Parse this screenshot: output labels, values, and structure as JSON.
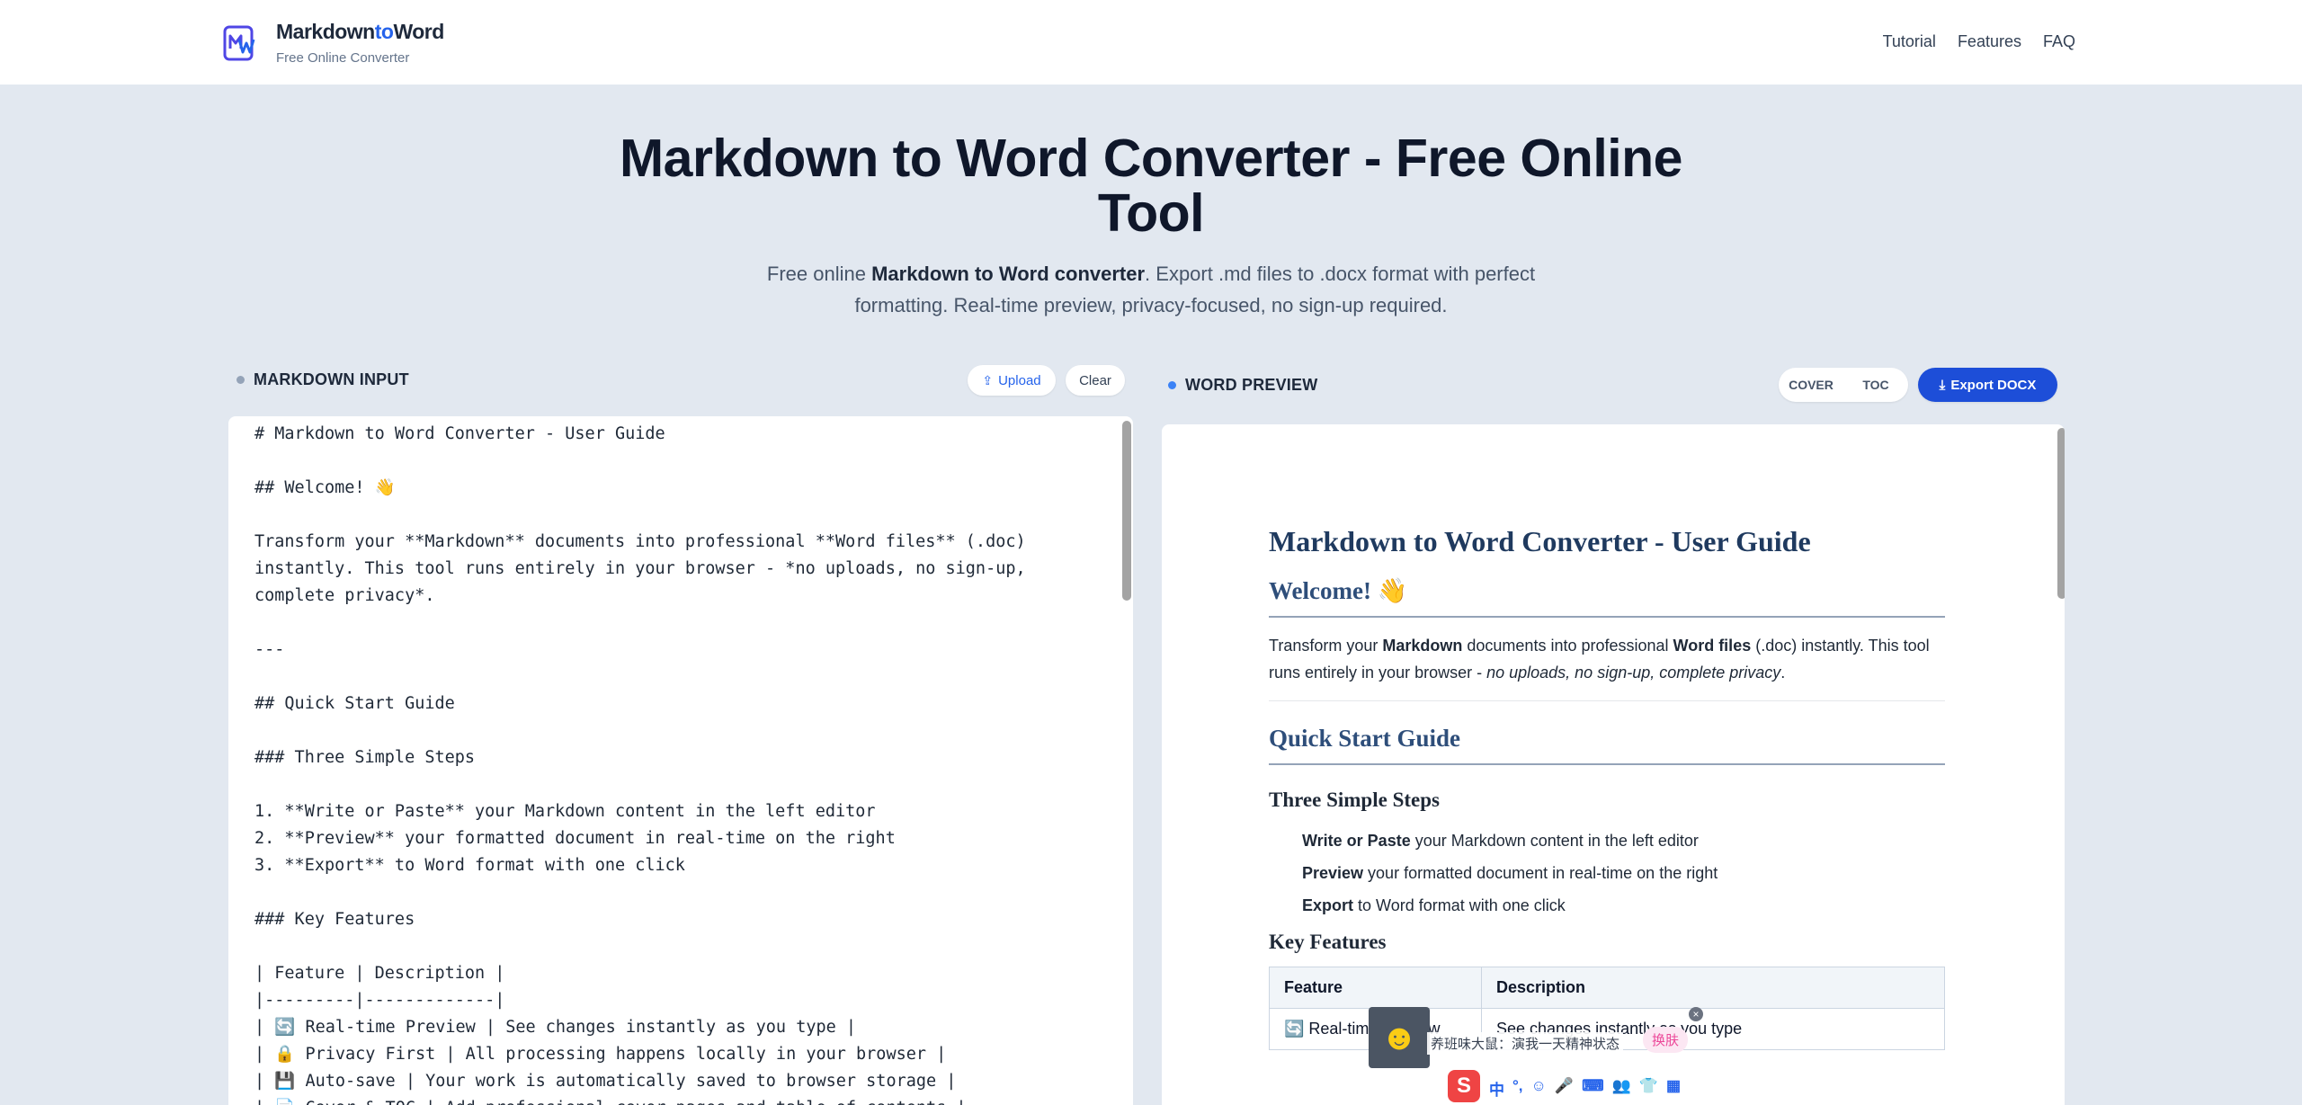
{
  "header": {
    "brand_part1": "Markdown",
    "brand_part2": "to",
    "brand_part3": "Word",
    "subtitle": "Free Online Converter",
    "nav": [
      "Tutorial",
      "Features",
      "FAQ"
    ]
  },
  "hero": {
    "title": "Markdown to Word Converter - Free Online Tool",
    "sub_1": "Free online ",
    "sub_bold": "Markdown to Word converter",
    "sub_2": ". Export .md files to .docx format with perfect formatting. Real-time preview, privacy-focused, no sign-up required."
  },
  "input_panel": {
    "label": "MARKDOWN INPUT",
    "upload_label": "Upload",
    "clear_label": "Clear",
    "lines": [
      "# Markdown to Word Converter - User Guide",
      "",
      "## Welcome! 👋",
      "",
      "Transform your **Markdown** documents into professional **Word files** (.doc)",
      "instantly. This tool runs entirely in your browser - *no uploads, no sign-up,",
      "complete privacy*.",
      "",
      "---",
      "",
      "## Quick Start Guide",
      "",
      "### Three Simple Steps",
      "",
      "1. **Write or Paste** your Markdown content in the left editor",
      "2. **Preview** your formatted document in real-time on the right",
      "3. **Export** to Word format with one click",
      "",
      "### Key Features",
      "",
      "| Feature | Description |",
      "|---------|-------------|",
      "| 🔄 Real-time Preview | See changes instantly as you type |",
      "| 🔒 Privacy First | All processing happens locally in your browser |",
      "| 💾 Auto-save | Your work is automatically saved to browser storage |",
      "| 📄 Cover & TOC | Add professional cover pages and table of contents |"
    ]
  },
  "preview_panel": {
    "label": "WORD PREVIEW",
    "cover_label": "COVER",
    "toc_label": "TOC",
    "export_label": "Export DOCX",
    "doc": {
      "h1": "Markdown to Word Converter - User Guide",
      "welcome": "Welcome! 👋",
      "p_1": "Transform your ",
      "p_b1": "Markdown",
      "p_2": " documents into professional ",
      "p_b2": "Word files",
      "p_3": " (.doc) instantly. This tool runs entirely in your browser - ",
      "p_i": "no uploads, no sign-up, complete privacy",
      "p_4": ".",
      "quick_start": "Quick Start Guide",
      "three_steps": "Three Simple Steps",
      "steps": [
        {
          "bold": "Write or Paste",
          "rest": " your Markdown content in the left editor"
        },
        {
          "bold": "Preview",
          "rest": " your formatted document in real-time on the right"
        },
        {
          "bold": "Export",
          "rest": " to Word format with one click"
        }
      ],
      "key_features": "Key Features",
      "table_header": [
        "Feature",
        "Description"
      ],
      "table_row_1": [
        "🔄 Real-time Preview",
        "See changes instantly as you type"
      ]
    }
  },
  "ime": {
    "news": "养班味大鼠：演我一天精神状态",
    "tag": "换肤",
    "logo": "S",
    "tools": [
      "中",
      "°,",
      "☺",
      "🎤",
      "⌨",
      "👥",
      "👕",
      "▦"
    ]
  },
  "colors": {
    "accent": "#2563eb",
    "background": "#e2e8f0",
    "doc_heading": "#1f3a5f"
  }
}
